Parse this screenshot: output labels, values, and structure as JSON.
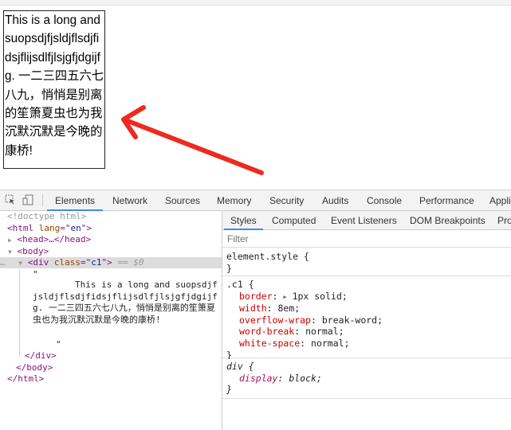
{
  "demo": {
    "text": "This is a long and suopsdjfjsldjflsdjfidsjflijsdlfjlsjgfjdgijfg. 一二三四五六七八九，悄悄是别离的笙箫夏虫也为我沉默沉默是今晚的康桥!"
  },
  "annotation": {
    "arrow_color": "#ee2a1f"
  },
  "devtools": {
    "toolbar_icons": [
      "inspect-element-icon",
      "device-toolbar-icon"
    ],
    "tabs": [
      {
        "label": "Elements",
        "active": true
      },
      {
        "label": "Network"
      },
      {
        "label": "Sources"
      },
      {
        "label": "Memory"
      },
      {
        "label": "Security"
      },
      {
        "label": "Audits"
      },
      {
        "label": "Console"
      },
      {
        "label": "Performance"
      },
      {
        "label": "Appli"
      }
    ],
    "elements": {
      "doctype": "<!doctype html>",
      "html_tag": "html",
      "html_attr": "lang",
      "html_attr_value": "en",
      "head": "<head>…</head>",
      "body": "<body>",
      "div_tag": "div",
      "div_attr": "class",
      "div_attr_value": "c1",
      "selected_marker": "== $0",
      "quote": "\"",
      "text_node": "        This is a long and suopsdjfjsldjflsdjfidsjflijsdlfjlsjgfjdgijfg. 一二三四五六七八九，悄悄是别离的笙箫夏虫也为我沉默沉默是今晚的康桥!",
      "div_close": "</div>",
      "body_close": "</body>",
      "html_close": "</html>",
      "ellipsis": "…"
    },
    "sidebar": {
      "tabs": [
        {
          "label": "Styles",
          "active": true
        },
        {
          "label": "Computed"
        },
        {
          "label": "Event Listeners"
        },
        {
          "label": "DOM Breakpoints"
        },
        {
          "label": "Pro"
        }
      ],
      "filter_placeholder": "Filter",
      "rules": [
        {
          "selector": "element.style {",
          "declarations": [],
          "close": "}"
        },
        {
          "selector": ".c1 {",
          "declarations": [
            {
              "prop": "border",
              "value": "1px solid;",
              "expandable": true
            },
            {
              "prop": "width",
              "value": "8em;"
            },
            {
              "prop": "overflow-wrap",
              "value": "break-word;"
            },
            {
              "prop": "word-break",
              "value": "normal;"
            },
            {
              "prop": "white-space",
              "value": "normal;"
            }
          ],
          "close": "}"
        },
        {
          "selector": "div {",
          "declarations": [
            {
              "prop": "display",
              "value": "block;"
            }
          ],
          "close": "}",
          "user_agent": true
        }
      ]
    }
  }
}
